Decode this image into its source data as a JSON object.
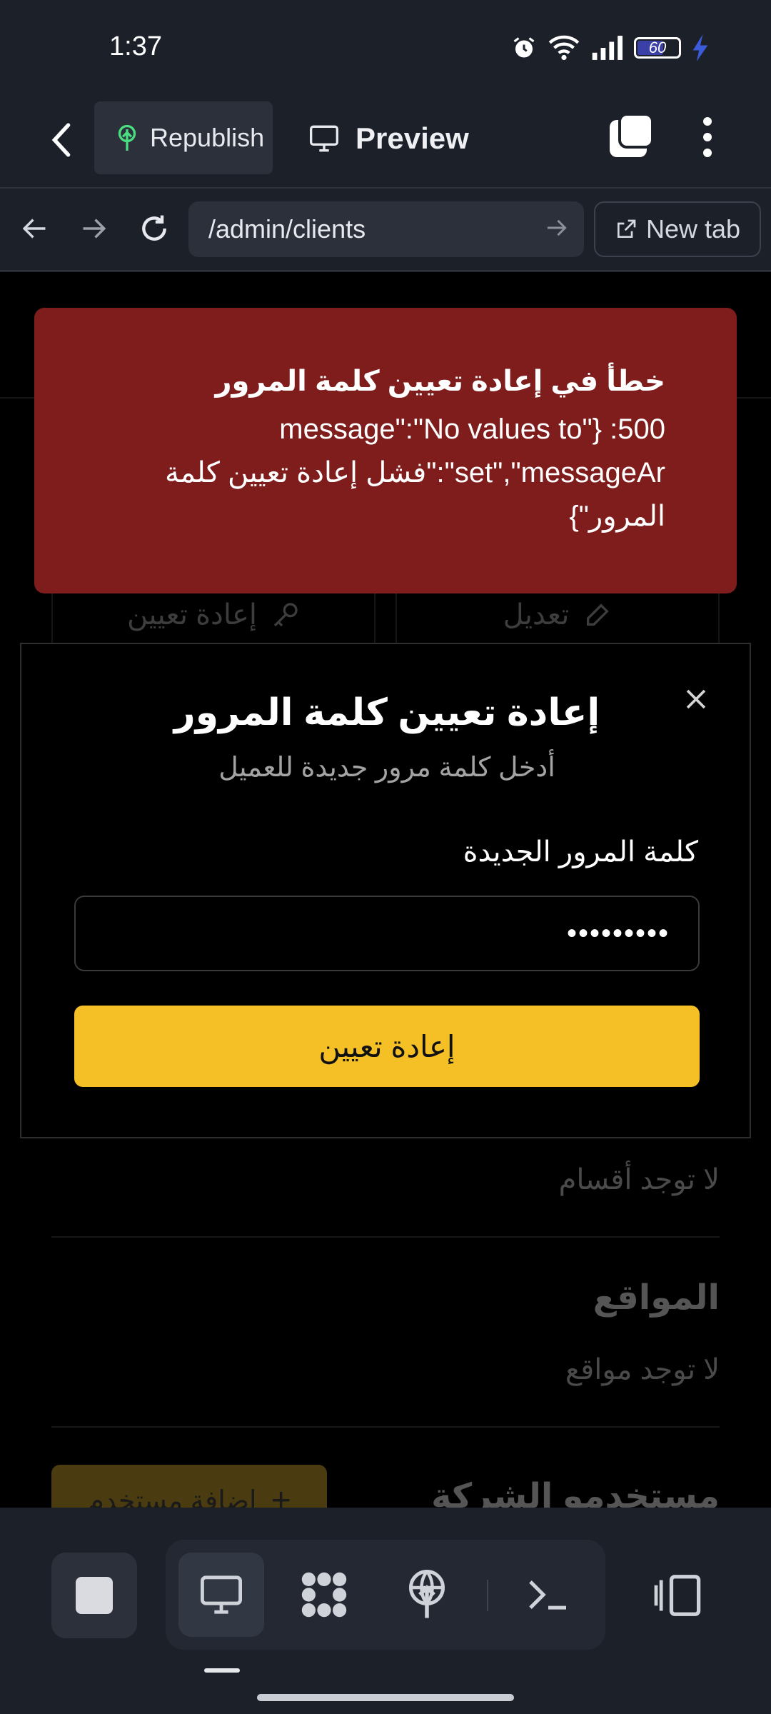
{
  "status_bar": {
    "time": "1:37",
    "battery_level": "60",
    "icons": [
      "alarm-icon",
      "wifi-icon",
      "signal-icon",
      "battery-icon",
      "charging-bolt-icon"
    ]
  },
  "app_bar": {
    "republish_label": "Republish",
    "preview_label": "Preview"
  },
  "browser": {
    "url": "/admin/clients",
    "new_tab_label": "New tab"
  },
  "toast": {
    "title": "خطأ في إعادة تعيين كلمة المرور",
    "message": "500: {\"message\":\"No values to set\",\"messageAr\":\"فشل إعادة تعيين كلمة المرور\"}"
  },
  "background": {
    "edit_label": "تعديل",
    "reset_label": "إعادة تعيين",
    "no_departments": "لا توجد أقسام",
    "locations_heading": "المواقع",
    "no_locations": "لا توجد مواقع",
    "company_users_heading": "مستخدمو الشركة",
    "add_user_label": "إضافة مستخدم"
  },
  "dialog": {
    "title": "إعادة تعيين كلمة المرور",
    "subtitle": "أدخل كلمة مرور جديدة للعميل",
    "field_label": "كلمة المرور الجديدة",
    "password_value": "•••••••••",
    "submit_label": "إعادة تعيين"
  },
  "colors": {
    "toast_bg": "#7f1d1d",
    "primary_button": "#f4c025",
    "chrome_bg": "#1c2029"
  }
}
